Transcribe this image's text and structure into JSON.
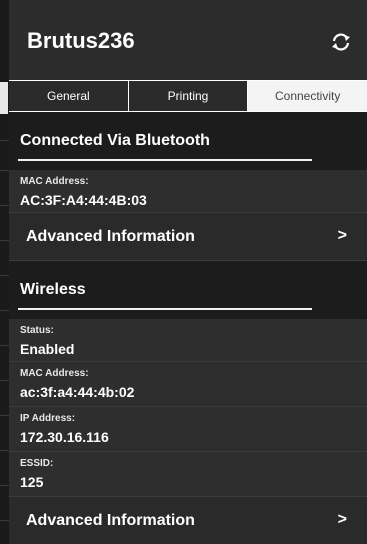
{
  "header": {
    "title": "Brutus236",
    "refresh_icon": "refresh-icon"
  },
  "tabs": [
    {
      "label": "General",
      "active": false
    },
    {
      "label": "Printing",
      "active": false
    },
    {
      "label": "Connectivity",
      "active": true
    }
  ],
  "bluetooth": {
    "section_title": "Connected Via Bluetooth",
    "fields": [
      {
        "key": "MAC Address:",
        "value": "AC:3F:A4:44:4B:03"
      }
    ],
    "advanced_label": "Advanced Information",
    "advanced_chevron": ">"
  },
  "wireless": {
    "section_title": "Wireless",
    "fields": [
      {
        "key": "Status:",
        "value": "Enabled"
      },
      {
        "key": "MAC Address:",
        "value": "ac:3f:a4:44:4b:02"
      },
      {
        "key": "IP Address:",
        "value": "172.30.16.116"
      },
      {
        "key": "ESSID:",
        "value": "125"
      }
    ],
    "advanced_label": "Advanced Information",
    "advanced_chevron": ">"
  },
  "colors": {
    "background": "#2b2b2b",
    "section": "#1c1c1c",
    "active_tab": "#f4f4f4"
  }
}
